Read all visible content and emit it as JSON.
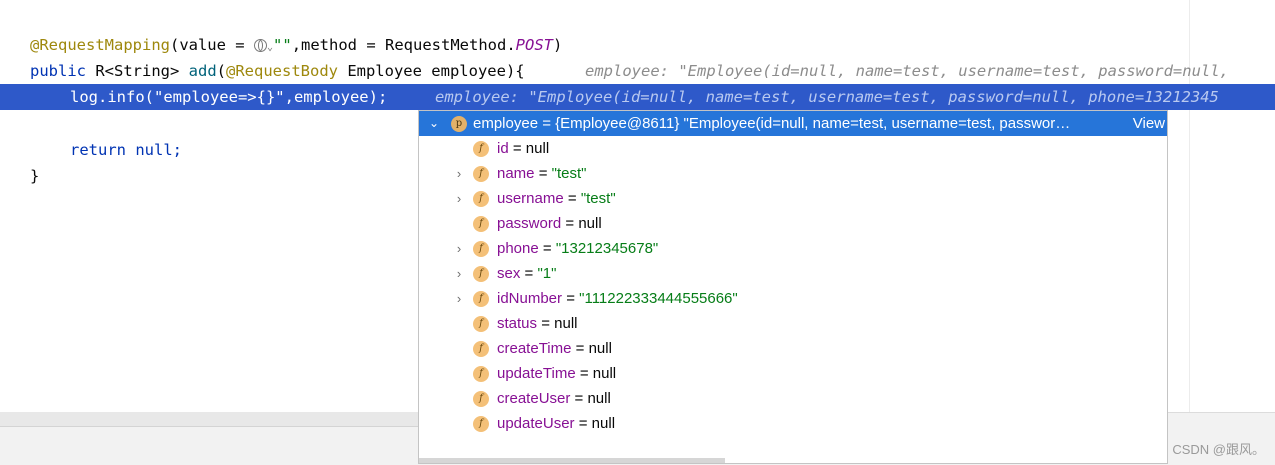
{
  "editor": {
    "line1": {
      "annotation": "@RequestMapping",
      "paren_open": "(value = ",
      "string": "\"\"",
      "mid": ",method = RequestMethod.",
      "constant": "POST",
      "paren_close": ")"
    },
    "line2": {
      "keyword": "public",
      "type_part": " R<String> ",
      "method": "add",
      "paren": "(",
      "annotation": "@RequestBody",
      "params": " Employee employee){",
      "inline_hint": "employee: \"Employee(id=null, name=test, username=test, password=null, "
    },
    "line3": {
      "code": "log.info(\"employee=>{}\",employee);",
      "inline_hint": "employee: \"Employee(id=null, name=test, username=test, password=null, phone=13212345"
    },
    "line5": {
      "keyword": "return",
      "value": " null;"
    },
    "line6": {
      "code": "}"
    }
  },
  "debug_popup": {
    "header_badge": "p",
    "header_text": "employee = {Employee@8611} \"Employee(id=null, name=test, username=test, passwor…",
    "header_link": "View",
    "fields": [
      {
        "badge": "f",
        "name": "id",
        "eq": " = ",
        "value": "null",
        "value_type": "null",
        "expandable": false
      },
      {
        "badge": "f",
        "name": "name",
        "eq": " = ",
        "value": "\"test\"",
        "value_type": "string",
        "expandable": true
      },
      {
        "badge": "f",
        "name": "username",
        "eq": " = ",
        "value": "\"test\"",
        "value_type": "string",
        "expandable": true
      },
      {
        "badge": "f",
        "name": "password",
        "eq": " = ",
        "value": "null",
        "value_type": "null",
        "expandable": false
      },
      {
        "badge": "f",
        "name": "phone",
        "eq": " = ",
        "value": "\"13212345678\"",
        "value_type": "string",
        "expandable": true
      },
      {
        "badge": "f",
        "name": "sex",
        "eq": " = ",
        "value": "\"1\"",
        "value_type": "string",
        "expandable": true
      },
      {
        "badge": "f",
        "name": "idNumber",
        "eq": " = ",
        "value": "\"111222333444555666\"",
        "value_type": "string",
        "expandable": true
      },
      {
        "badge": "f",
        "name": "status",
        "eq": " = ",
        "value": "null",
        "value_type": "null",
        "expandable": false
      },
      {
        "badge": "f",
        "name": "createTime",
        "eq": " = ",
        "value": "null",
        "value_type": "null",
        "expandable": false
      },
      {
        "badge": "f",
        "name": "updateTime",
        "eq": " = ",
        "value": "null",
        "value_type": "null",
        "expandable": false
      },
      {
        "badge": "f",
        "name": "createUser",
        "eq": " = ",
        "value": "null",
        "value_type": "null",
        "expandable": false
      },
      {
        "badge": "f",
        "name": "updateUser",
        "eq": " = ",
        "value": "null",
        "value_type": "null",
        "expandable": false
      }
    ]
  },
  "watermark": "CSDN @跟风。",
  "colors": {
    "selection_line": "#2e59c9",
    "popup_header": "#2675d9",
    "field_name": "#871094",
    "string_value": "#067d17",
    "annotation": "#9e880d",
    "keyword": "#0033b3"
  }
}
